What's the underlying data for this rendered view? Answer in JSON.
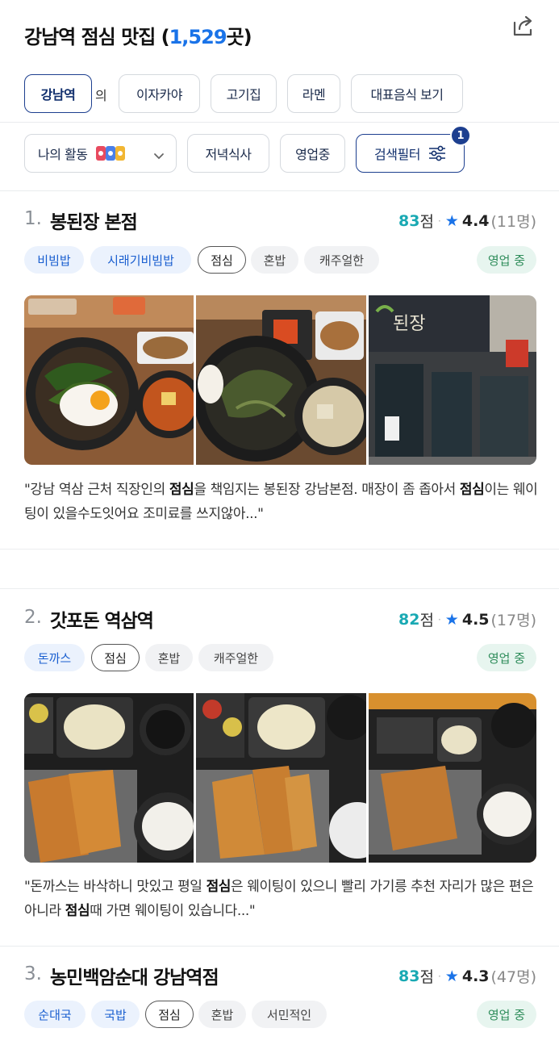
{
  "header": {
    "title_prefix": "강남역 점심 맛집 (",
    "count": "1,529",
    "title_suffix": "곳)"
  },
  "keyword_row": {
    "location": "강남역",
    "particle": "의",
    "keywords": [
      "이자카야",
      "고기집",
      "라멘",
      "대표음식 보기"
    ]
  },
  "filter_row": {
    "my_activity": "나의 활동",
    "dinner": "저녁식사",
    "open_now": "영업중",
    "search_filter": "검색필터",
    "filter_count": "1"
  },
  "restaurants": [
    {
      "rank": "1.",
      "name": "봉된장 본점",
      "score": "83",
      "score_unit": "점",
      "rating": "4.4",
      "reviews": "(11명)",
      "tags": [
        "비빔밥",
        "시래기비빔밥",
        "점심",
        "혼밥",
        "캐주얼한"
      ],
      "status": "영업 중",
      "review_parts": [
        "\"강남 역삼 근처 직장인의 ",
        "점심",
        "을 책임지는 봉된장 강남본점. 매장이 좀 좁아서 ",
        "점심",
        "이는 웨이팅이 있을수도잇어요 조미료를 쓰지않아...\""
      ]
    },
    {
      "rank": "2.",
      "name": "갓포돈 역삼역",
      "score": "82",
      "score_unit": "점",
      "rating": "4.5",
      "reviews": "(17명)",
      "tags": [
        "돈까스",
        "점심",
        "혼밥",
        "캐주얼한"
      ],
      "status": "영업 중",
      "review_parts": [
        "\"돈까스는 바삭하니 맛있고 평일 ",
        "점심",
        "은 웨이팅이 있으니 빨리 가기릉 추천 자리가 많은 편은 아니라 ",
        "점심",
        "때 가면 웨이팅이 있습니다...\""
      ]
    },
    {
      "rank": "3.",
      "name": "농민백암순대 강남역점",
      "score": "83",
      "score_unit": "점",
      "rating": "4.3",
      "reviews": "(47명)",
      "tags": [
        "순대국",
        "국밥",
        "점심",
        "혼밥",
        "서민적인"
      ],
      "status": "영업 중"
    }
  ],
  "icons": {
    "share": "share-icon",
    "star": "star-icon",
    "chevron": "chevron-down-icon",
    "filter": "sliders-icon"
  },
  "colors": {
    "accent": "#1a73e8",
    "score": "#19a9b3",
    "open": "#2f8d5b",
    "navy": "#1d3f8f"
  }
}
